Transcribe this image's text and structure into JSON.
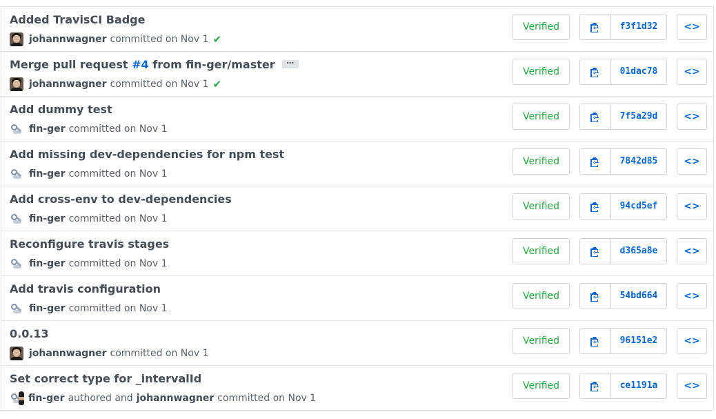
{
  "commits": [
    {
      "title": "Added TravisCI Badge",
      "avatar": "user",
      "author": "johannwagner",
      "verb": "committed on Nov 1",
      "checked": true,
      "verified": "Verified",
      "sha": "f3f1d32"
    },
    {
      "title_prefix": "Merge pull request ",
      "pr": "#4",
      "title_suffix": " from fin-ger/master",
      "ellipsis": "…",
      "avatar": "user",
      "author": "johannwagner",
      "verb": "committed on Nov 1",
      "checked": true,
      "verified": "Verified",
      "sha": "01dac78"
    },
    {
      "title": "Add dummy test",
      "avatar": "bot",
      "author": "fin-ger",
      "verb": "committed on Nov 1",
      "verified": "Verified",
      "sha": "7f5a29d"
    },
    {
      "title": "Add missing dev-dependencies for npm test",
      "avatar": "bot",
      "author": "fin-ger",
      "verb": "committed on Nov 1",
      "verified": "Verified",
      "sha": "7842d85"
    },
    {
      "title": "Add cross-env to dev-dependencies",
      "avatar": "bot",
      "author": "fin-ger",
      "verb": "committed on Nov 1",
      "verified": "Verified",
      "sha": "94cd5ef"
    },
    {
      "title": "Reconfigure travis stages",
      "avatar": "bot",
      "author": "fin-ger",
      "verb": "committed on Nov 1",
      "verified": "Verified",
      "sha": "d365a8e"
    },
    {
      "title": "Add travis configuration",
      "avatar": "bot",
      "author": "fin-ger",
      "verb": "committed on Nov 1",
      "verified": "Verified",
      "sha": "54bd664"
    },
    {
      "title": "0.0.13",
      "avatar": "user",
      "author": "johannwagner",
      "verb": "committed on Nov 1",
      "verified": "Verified",
      "sha": "96151e2"
    },
    {
      "title": "Set correct type for _intervalId",
      "avatar": "both",
      "author": "fin-ger",
      "verb": "authored and",
      "coauthor": "johannwagner",
      "verb2": "committed on Nov 1",
      "verified": "Verified",
      "sha": "ce1191a"
    }
  ],
  "icons": {
    "copy": "clippy-icon",
    "browse": "code-icon",
    "check": "check-icon"
  },
  "colors": {
    "link": "#0366d6",
    "verified": "#28a745",
    "border": "#e1e4e8"
  }
}
